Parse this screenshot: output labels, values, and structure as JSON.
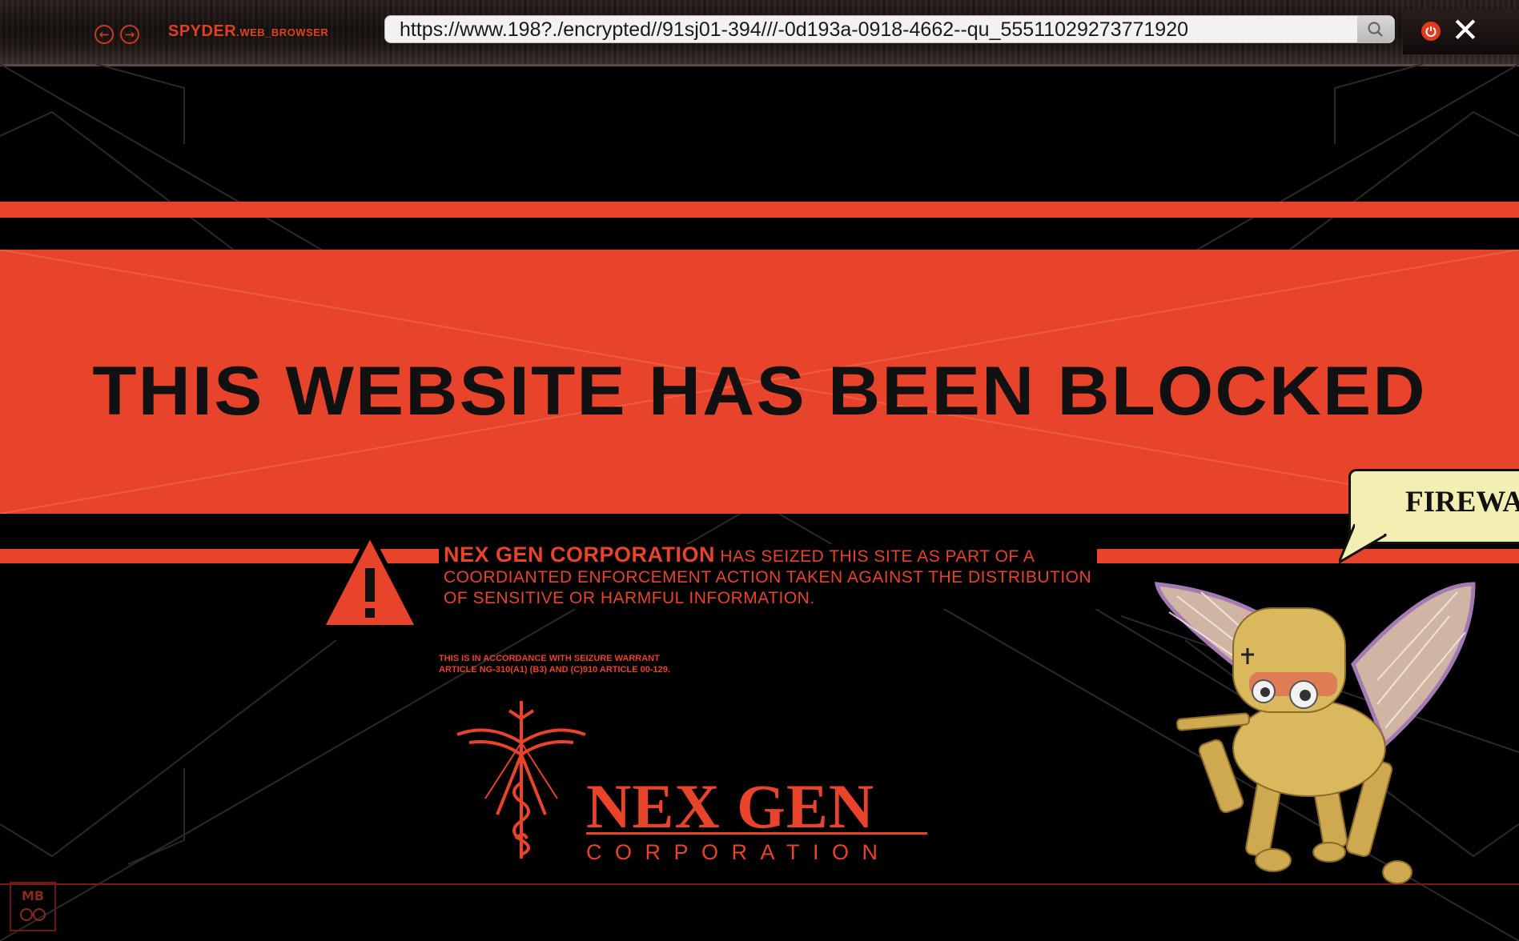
{
  "browser": {
    "brand_main": "SPYDER",
    "brand_sub": ".WEB_BROWSER",
    "url": "https://www.198?./encrypted//91sj01-394///-0d193a-0918-4662--qu_55511029273771920",
    "icons": [
      "back-arrow-icon",
      "forward-arrow-icon",
      "search-icon",
      "power-icon",
      "close-icon"
    ]
  },
  "page": {
    "headline": "THIS WEBSITE HAS BEEN BLOCKED",
    "notice_corp": "NEX GEN CORPORATION",
    "notice_rest": "HAS SEIZED THIS SITE AS PART OF A COORDIANTED ENFORCEMENT ACTION TAKEN AGAINST THE DISTRIBUTION OF SENSITIVE OR HARMFUL INFORMATION.",
    "fine_line1": "THIS IS IN ACCORDANCE WITH SEIZURE WARRANT",
    "fine_line2": "ARTICLE NG-310(A1) (B3) AND (C)910 ARTICLE 00-129.",
    "logo_name": "NEX GEN",
    "logo_sub": "CORPORATION",
    "badge": "MB"
  },
  "creature": {
    "speech": "FIREWA"
  },
  "colors": {
    "accent_red": "#e8432b",
    "bubble_yellow": "#f3efb3",
    "creature_gold": "#d9b85e"
  }
}
